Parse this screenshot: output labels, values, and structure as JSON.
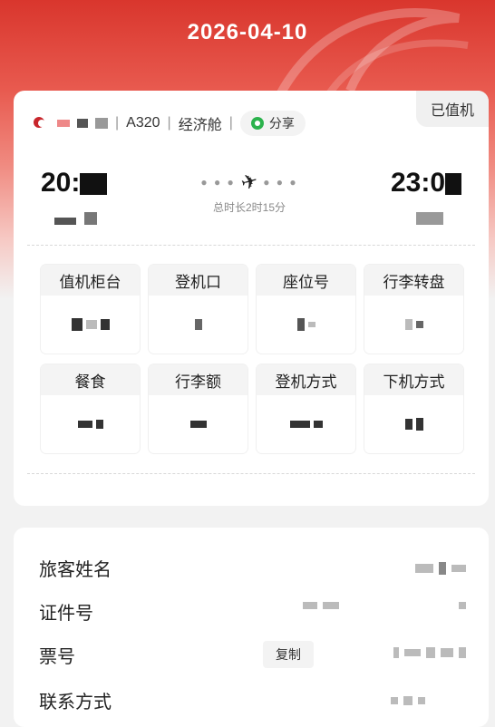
{
  "header": {
    "date": "2026-04-10"
  },
  "flight": {
    "status": "已值机",
    "aircraft": "A320",
    "cabin": "经济舱",
    "share_label": "分享",
    "departure_time": "20:",
    "arrival_time": "23:0",
    "duration": "总时长2时15分"
  },
  "info_cells": [
    {
      "label": "值机柜台"
    },
    {
      "label": "登机口"
    },
    {
      "label": "座位号"
    },
    {
      "label": "行李转盘"
    },
    {
      "label": "餐食"
    },
    {
      "label": "行李额"
    },
    {
      "label": "登机方式"
    },
    {
      "label": "下机方式"
    }
  ],
  "passenger": {
    "name_label": "旅客姓名",
    "id_label": "证件号",
    "ticket_label": "票号",
    "copy_label": "复制",
    "contact_label": "联系方式"
  },
  "colors": {
    "brand_red": "#d9362d",
    "wechat_green": "#2bb24c"
  }
}
